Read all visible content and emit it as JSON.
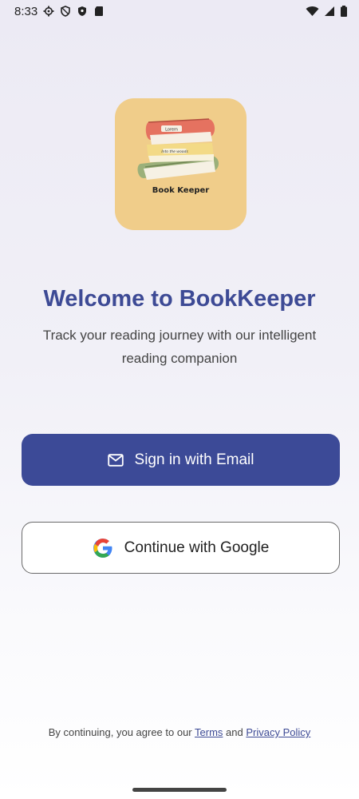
{
  "status_bar": {
    "time": "8:33",
    "left_icons": [
      "gear-icon",
      "shield-icon",
      "shield-filled-icon",
      "sd-card-icon"
    ],
    "right_icons": [
      "wifi-icon",
      "signal-icon",
      "battery-icon"
    ]
  },
  "logo": {
    "text": "Book Keeper",
    "book_labels": [
      "Lorem",
      "Into the woods"
    ],
    "colors": {
      "tile": "#f0cd8a",
      "book_top": "#e57260",
      "book_mid": "#f3da86",
      "book_bottom": "#9bb07a"
    }
  },
  "welcome": {
    "title": "Welcome to BookKeeper",
    "subtitle": "Track your reading journey with our intelligent reading companion"
  },
  "buttons": {
    "email": {
      "label": "Sign in with Email",
      "icon": "mail-icon"
    },
    "google": {
      "label": "Continue with Google",
      "icon": "google-icon"
    }
  },
  "legal": {
    "prefix": "By continuing, you agree to our",
    "terms": "Terms",
    "and": "and",
    "privacy": "Privacy Policy"
  },
  "colors": {
    "accent": "#3c4a97",
    "title": "#3d4a95"
  }
}
